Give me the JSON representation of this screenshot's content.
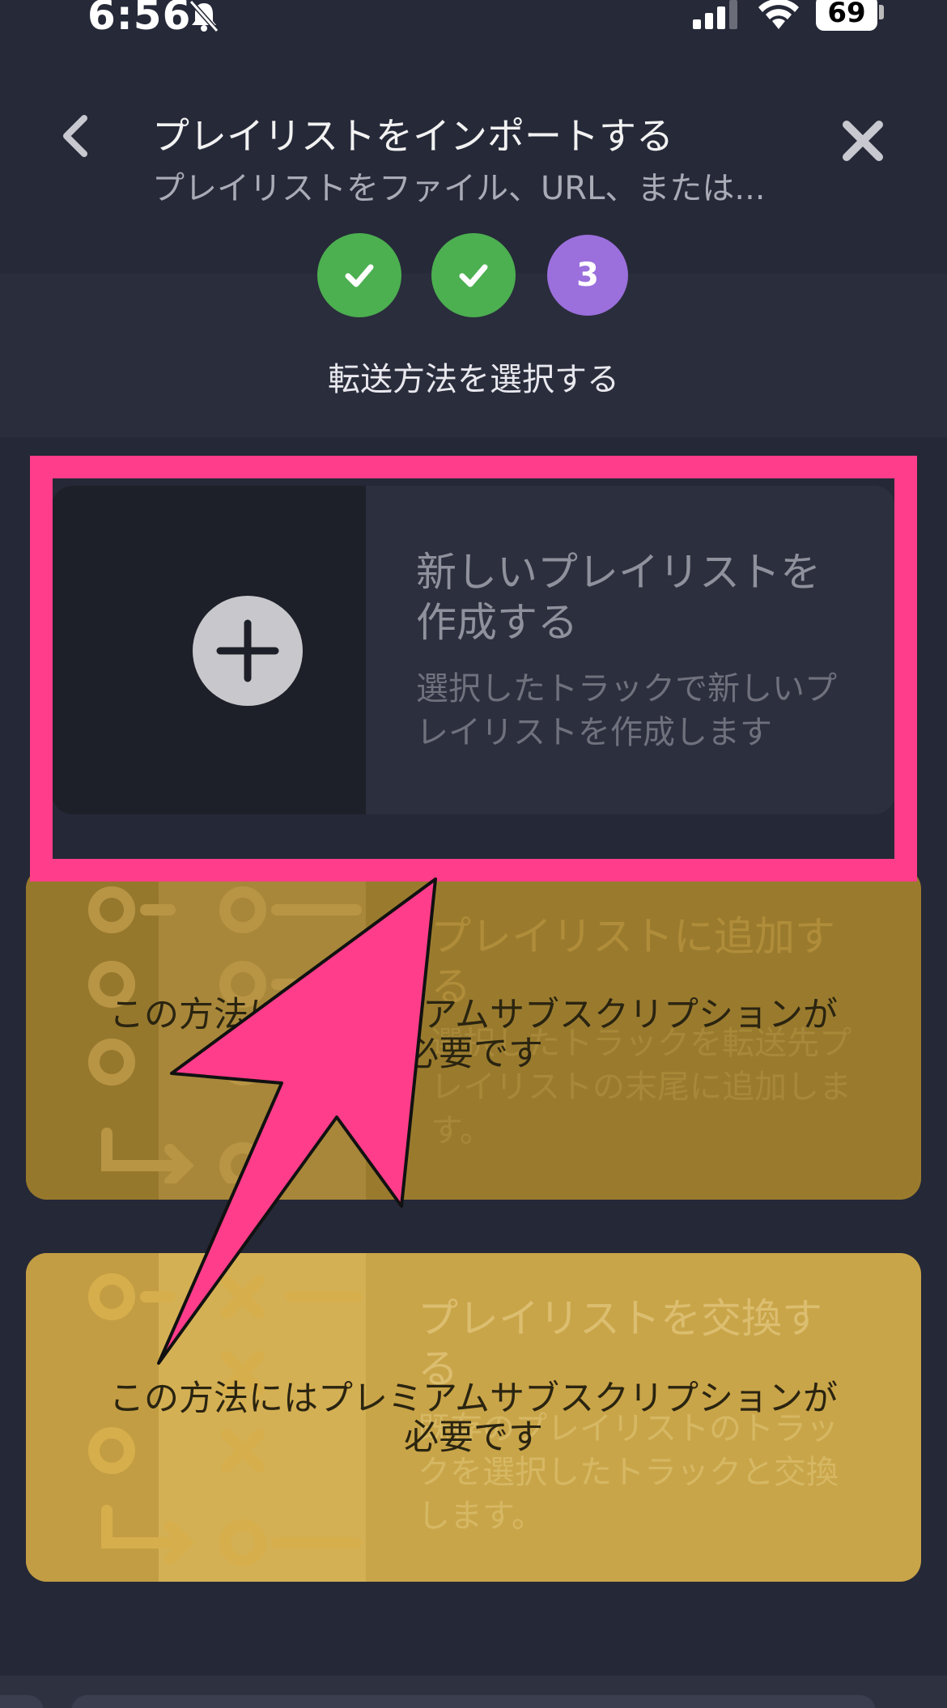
{
  "status": {
    "time": "6:56",
    "battery": "69"
  },
  "header": {
    "title": "プレイリストをインポートする",
    "subtitle": "プレイリストをファイル、URL、または..."
  },
  "stepper": {
    "steps": [
      {
        "state": "done"
      },
      {
        "state": "done"
      },
      {
        "state": "current",
        "number": "3"
      }
    ],
    "label": "転送方法を選択する"
  },
  "options": {
    "new_playlist": {
      "title_line1": "新しいプレイリストを",
      "title_line2": "作成する",
      "desc_line1": "選択したトラックで新しいプ",
      "desc_line2": "レイリストを作成します"
    },
    "add_to_playlist": {
      "title_line1": "プレイリストに追加す",
      "title_line2": "る",
      "desc_line1": "選択したトラックを転送先プ",
      "desc_line2": "レイリストの末尾に追加しま",
      "desc_line3": "す。",
      "premium_line1": "この方法にはプレミアムサブスクリプションが",
      "premium_line2": "必要です"
    },
    "replace_playlist": {
      "title_line1": "プレイリストを交換す",
      "title_line2": "る",
      "desc_line1": "既存のプレイリストのトラッ",
      "desc_line2": "クを選択したトラックと交換",
      "desc_line3": "します。",
      "premium_line1": "この方法にはプレミアムサブスクリプションが",
      "premium_line2": "必要です"
    }
  },
  "colors": {
    "background": "#252836",
    "step_done": "#4caf50",
    "step_current": "#9b6fdc",
    "highlight": "#ff3d8a",
    "premium_gold": "#c9a549"
  }
}
